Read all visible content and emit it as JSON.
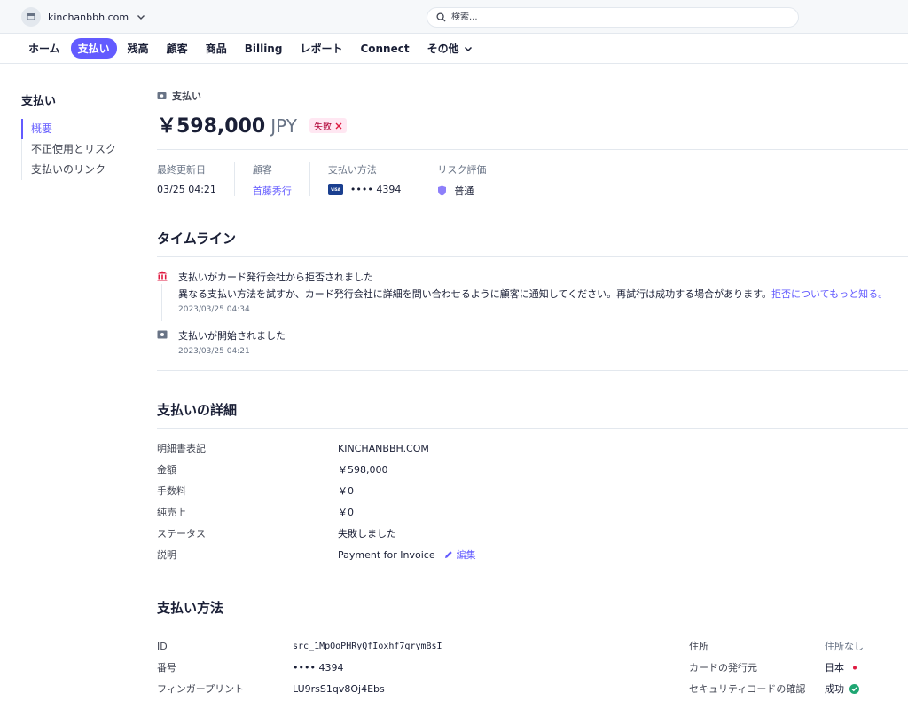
{
  "account": {
    "name": "kinchanbbh.com"
  },
  "search": {
    "placeholder": "検索..."
  },
  "nav": {
    "items": [
      "ホーム",
      "支払い",
      "残高",
      "顧客",
      "商品",
      "Billing",
      "レポート",
      "Connect",
      "その他"
    ]
  },
  "sidebar": {
    "title": "支払い",
    "items": [
      "概要",
      "不正使用とリスク",
      "支払いのリンク"
    ]
  },
  "header": {
    "breadcrumb": "支払い",
    "amount": "￥598,000",
    "currency": "JPY",
    "status": "失敗"
  },
  "summary": {
    "updated_label": "最終更新日",
    "updated_value": "03/25 04:21",
    "customer_label": "顧客",
    "customer_value": "首藤秀行",
    "method_label": "支払い方法",
    "card_brand": "VISA",
    "method_value": "•••• 4394",
    "risk_label": "リスク評価",
    "risk_value": "普通"
  },
  "timeline": {
    "title": "タイムライン",
    "events": [
      {
        "title": "支払いがカード発行会社から拒否されました",
        "desc": "異なる支払い方法を試すか、カード発行会社に詳細を問い合わせるように顧客に通知してください。再試行は成功する場合があります。",
        "link": "拒否についてもっと知る。",
        "time": "2023/03/25 04:34"
      },
      {
        "title": "支払いが開始されました",
        "time": "2023/03/25 04:21"
      }
    ]
  },
  "details": {
    "title": "支払いの詳細",
    "rows": [
      {
        "label": "明細書表記",
        "value": "KINCHANBBH.COM"
      },
      {
        "label": "金額",
        "value": "￥598,000"
      },
      {
        "label": "手数料",
        "value": "￥0"
      },
      {
        "label": "純売上",
        "value": "￥0"
      },
      {
        "label": "ステータス",
        "value": "失敗しました"
      },
      {
        "label": "説明",
        "value": "Payment for Invoice"
      }
    ],
    "edit_label": "編集"
  },
  "payment_method": {
    "title": "支払い方法",
    "left": [
      {
        "label": "ID",
        "value": "src_1MpOoPHRyQfIoxhf7qrymBsI"
      },
      {
        "label": "番号",
        "value": "•••• 4394"
      },
      {
        "label": "フィンガープリント",
        "value": "LU9rsS1qv8Oj4Ebs"
      }
    ],
    "right": [
      {
        "label": "住所",
        "value": "住所なし"
      },
      {
        "label": "カードの発行元",
        "value": "日本"
      },
      {
        "label": "セキュリティコードの確認",
        "value": "成功"
      }
    ]
  },
  "colors": {
    "accent": "#635bff",
    "danger": "#df1b41",
    "success": "#1ea672"
  }
}
